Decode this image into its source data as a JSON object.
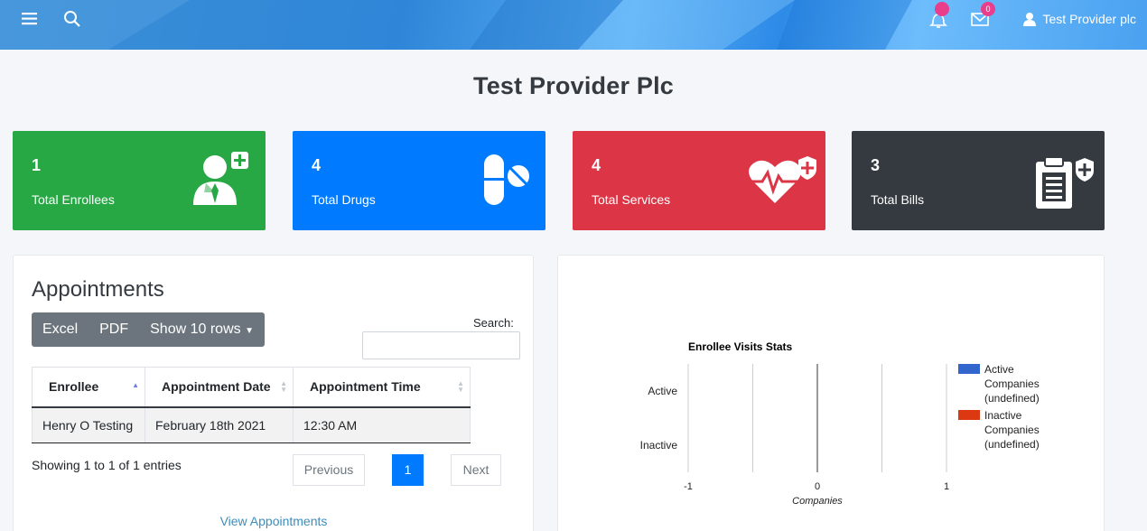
{
  "header": {
    "user_name": "Test Provider plc",
    "notification_count": "",
    "message_count": "0"
  },
  "page": {
    "title": "Test Provider Plc"
  },
  "cards": [
    {
      "value": "1",
      "label": "Total Enrollees",
      "icon": "user-plus-icon",
      "color": "#28a745"
    },
    {
      "value": "4",
      "label": "Total Drugs",
      "icon": "pills-icon",
      "color": "#007bff"
    },
    {
      "value": "4",
      "label": "Total Services",
      "icon": "heartbeat-shield-icon",
      "color": "#dc3545"
    },
    {
      "value": "3",
      "label": "Total Bills",
      "icon": "clipboard-shield-icon",
      "color": "#343a40"
    }
  ],
  "appointments": {
    "title": "Appointments",
    "buttons": {
      "excel": "Excel",
      "pdf": "PDF",
      "show_rows": "Show 10 rows"
    },
    "search_label": "Search:",
    "search_value": "",
    "columns": [
      "Enrollee",
      "Appointment Date",
      "Appointment Time"
    ],
    "rows": [
      [
        "Henry O Testing",
        "February 18th 2021",
        "12:30 AM"
      ]
    ],
    "info": "Showing 1 to 1 of 1 entries",
    "pagination": {
      "previous": "Previous",
      "current": "1",
      "next": "Next"
    },
    "view_link": "View Appointments"
  },
  "chart_data": {
    "type": "bar",
    "orientation": "horizontal",
    "title": "Enrollee Visits Stats",
    "categories": [
      "Active",
      "Inactive"
    ],
    "series": [
      {
        "name": "Active Companies (undefined)",
        "color": "#3366cc",
        "values": [
          0,
          0
        ]
      },
      {
        "name": "Inactive Companies (undefined)",
        "color": "#dc3912",
        "values": [
          0,
          0
        ]
      }
    ],
    "legend_lines": [
      [
        "Active",
        "Companies",
        "(undefined)"
      ],
      [
        "Inactive",
        "Companies",
        "(undefined)"
      ]
    ],
    "xlabel": "Companies",
    "ylabel": "",
    "xlim": [
      -1,
      1
    ],
    "xticks": [
      "-1",
      "0",
      "1"
    ],
    "grid": true,
    "legend_position": "right"
  }
}
